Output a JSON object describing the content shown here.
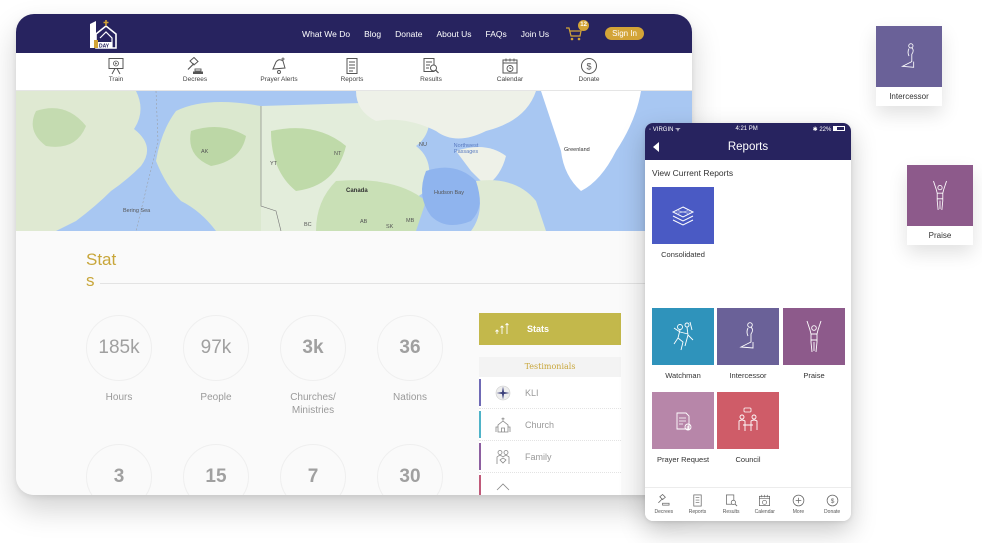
{
  "desktop": {
    "logo": {
      "number": "1",
      "text": "DAY"
    },
    "topnav": [
      {
        "label": "What We Do"
      },
      {
        "label": "Blog"
      },
      {
        "label": "Donate"
      },
      {
        "label": "About Us"
      },
      {
        "label": "FAQs"
      },
      {
        "label": "Join Us"
      }
    ],
    "cart_count": "12",
    "signin_label": "Sign In",
    "subnav": [
      {
        "label": "Train",
        "icon": "presentation-icon"
      },
      {
        "label": "Decrees",
        "icon": "gavel-icon"
      },
      {
        "label": "Prayer Alerts",
        "icon": "bell-icon"
      },
      {
        "label": "Reports",
        "icon": "document-icon"
      },
      {
        "label": "Results",
        "icon": "search-report-icon",
        "active": true
      },
      {
        "label": "Calendar",
        "icon": "calendar-icon"
      },
      {
        "label": "Donate",
        "icon": "dollar-icon"
      }
    ],
    "map_labels": {
      "bering_sea": "Bering Sea",
      "canada": "Canada",
      "hudson_bay": "Hudson Bay",
      "northwest_passages": "Northwest Passages",
      "greenland": "Greenland",
      "ak": "AK",
      "yt": "YT",
      "nt": "NT",
      "nu": "NU",
      "bc": "BC",
      "ab": "AB",
      "sk": "SK",
      "mb": "MB"
    },
    "stats": {
      "title": "Stats",
      "row1": [
        {
          "value": "185k",
          "label": "Hours"
        },
        {
          "value": "97k",
          "label": "People"
        },
        {
          "value": "3k",
          "label": "Churches/ Ministries"
        },
        {
          "value": "36",
          "label": "Nations"
        }
      ],
      "row2": [
        {
          "value": "3"
        },
        {
          "value": "15"
        },
        {
          "value": "7"
        },
        {
          "value": "30"
        }
      ]
    },
    "side_panel": {
      "stats_label": "Stats",
      "testimonials_heading": "Testimonials",
      "items": [
        {
          "label": "KLI"
        },
        {
          "label": "Church"
        },
        {
          "label": "Family"
        }
      ]
    }
  },
  "phone": {
    "carrier": "VIRGIN",
    "time": "4:21 PM",
    "battery": "22%",
    "title": "Reports",
    "section_label": "View Current Reports",
    "tiles": [
      {
        "label": "Consolidated",
        "color": "#4a5ac4"
      },
      {
        "label": "Watchman",
        "color": "#2f93bb"
      },
      {
        "label": "Intercessor",
        "color": "#6a6198"
      },
      {
        "label": "Praise",
        "color": "#8d5a8b"
      },
      {
        "label": "Prayer Request",
        "color": "#b786a9"
      },
      {
        "label": "Council",
        "color": "#cf5c68"
      }
    ],
    "tabbar": [
      {
        "label": "Decrees"
      },
      {
        "label": "Reports"
      },
      {
        "label": "Results"
      },
      {
        "label": "Calendar"
      },
      {
        "label": "More"
      },
      {
        "label": "Donate"
      }
    ]
  },
  "floating_cards": [
    {
      "label": "Intercessor",
      "color": "#6a6198"
    },
    {
      "label": "Praise",
      "color": "#8d5a8b"
    }
  ],
  "colors": {
    "brand_navy": "#27235f",
    "accent_gold": "#d3a437",
    "stats_olive": "#c3b84b"
  }
}
